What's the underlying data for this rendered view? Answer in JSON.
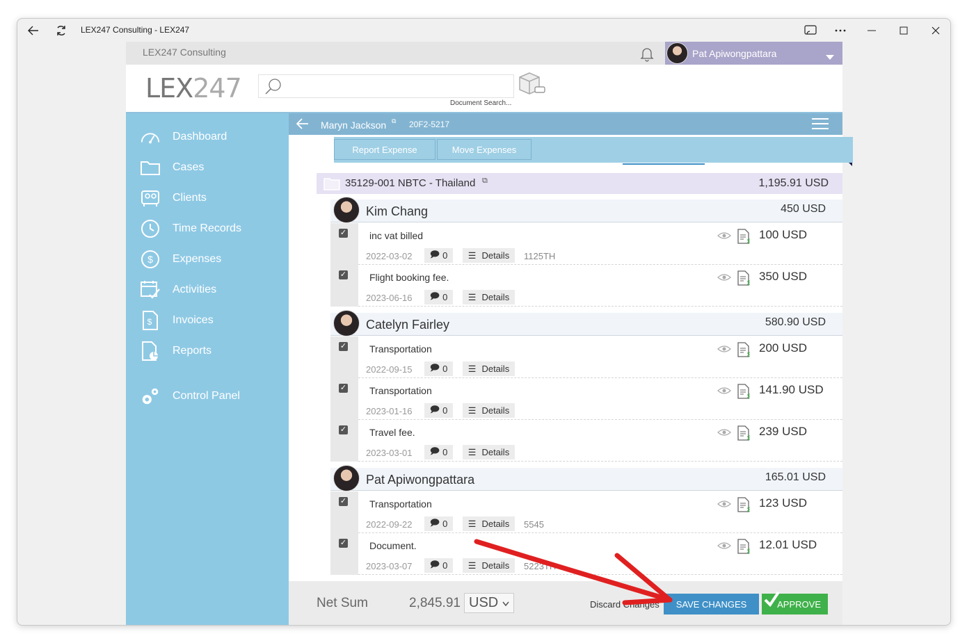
{
  "window": {
    "title": "LEX247 Consulting - LEX247"
  },
  "topbar": {
    "org_name": "LEX247 Consulting",
    "user_name": "Pat Apiwongpattara"
  },
  "header": {
    "logo_main": "LEX",
    "logo_light": "247",
    "search_label": "Document Search..."
  },
  "sidebar": {
    "items": [
      {
        "label": "Dashboard",
        "icon": "dashboard-icon"
      },
      {
        "label": "Cases",
        "icon": "folder-icon"
      },
      {
        "label": "Clients",
        "icon": "clients-icon"
      },
      {
        "label": "Time Records",
        "icon": "clock-icon"
      },
      {
        "label": "Expenses",
        "icon": "dollar-icon"
      },
      {
        "label": "Activities",
        "icon": "calendar-check-icon"
      },
      {
        "label": "Invoices",
        "icon": "invoice-icon"
      },
      {
        "label": "Reports",
        "icon": "report-icon"
      },
      {
        "label": "Control Panel",
        "icon": "gears-icon"
      }
    ]
  },
  "case": {
    "client_name": "Maryn Jackson",
    "case_code": "20F2-5217"
  },
  "popup": {
    "report_expense": "Report Expense",
    "move_expenses": "Move Expenses"
  },
  "folder": {
    "title": "35129-001 NBTC - Thailand",
    "total": "1,195.91 USD"
  },
  "people": [
    {
      "name": "Kim Chang",
      "total": "450 USD",
      "entries": [
        {
          "desc": "inc vat billed",
          "date": "2022-03-02",
          "comments": "0",
          "details": "Details",
          "ref": "1125TH",
          "amount": "100 USD"
        },
        {
          "desc": "Flight booking fee.",
          "date": "2023-06-16",
          "comments": "0",
          "details": "Details",
          "ref": "",
          "amount": "350 USD"
        }
      ]
    },
    {
      "name": "Catelyn Fairley",
      "total": "580.90 USD",
      "entries": [
        {
          "desc": "Transportation",
          "date": "2022-09-15",
          "comments": "0",
          "details": "Details",
          "ref": "",
          "amount": "200 USD"
        },
        {
          "desc": "Transportation",
          "date": "2023-01-16",
          "comments": "0",
          "details": "Details",
          "ref": "",
          "amount": "141.90 USD"
        },
        {
          "desc": "Travel fee.",
          "date": "2023-03-01",
          "comments": "0",
          "details": "Details",
          "ref": "",
          "amount": "239 USD"
        }
      ]
    },
    {
      "name": "Pat Apiwongpattara",
      "total": "165.01 USD",
      "entries": [
        {
          "desc": "Transportation",
          "date": "2022-09-22",
          "comments": "0",
          "details": "Details",
          "ref": "5545",
          "amount": "123 USD"
        },
        {
          "desc": "Document.",
          "date": "2023-03-07",
          "comments": "0",
          "details": "Details",
          "ref": "5223TH",
          "amount": "12.01 USD"
        }
      ]
    }
  ],
  "footer": {
    "net_sum_label": "Net Sum",
    "net_sum_value": "2,845.91",
    "currency": "USD",
    "discard": "Discard Changes",
    "save": "SAVE CHANGES",
    "approve": "APPROVE"
  },
  "colors": {
    "sidebar": "#8ec9e4",
    "casebar": "#82b4d2",
    "save": "#3f90c7",
    "approve": "#3fb14a",
    "folder_row": "#e6e1f3",
    "annotation_arrow": "#e02020"
  }
}
